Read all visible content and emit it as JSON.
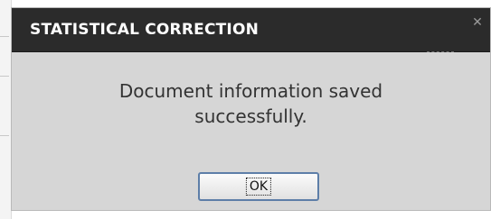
{
  "dialog": {
    "title": "STATISTICAL CORRECTION",
    "close_glyph": "✕",
    "message_line1": "Document information saved",
    "message_line2": "successfully.",
    "ok_label": "OK"
  },
  "colors": {
    "titlebar": "#2b2b2b",
    "dialog_bg": "#d6d6d6",
    "button_border": "#5d7ea8"
  },
  "icons": {
    "close": "close-icon"
  }
}
